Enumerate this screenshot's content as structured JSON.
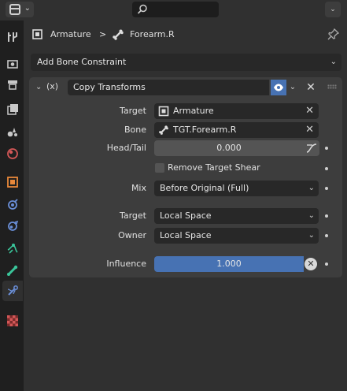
{
  "header": {
    "search_placeholder": ""
  },
  "breadcrumb": {
    "object": "Armature",
    "separator": ">",
    "bone": "Forearm.R"
  },
  "add_constraint": {
    "label": "Add Bone Constraint"
  },
  "constraint": {
    "name": "Copy Transforms",
    "type_symbol": "(x)",
    "fields": {
      "target_label": "Target",
      "target_value": "Armature",
      "bone_label": "Bone",
      "bone_value": "TGT.Forearm.R",
      "headtail_label": "Head/Tail",
      "headtail_value": "0.000",
      "remove_shear_label": "Remove Target Shear",
      "remove_shear_checked": false,
      "mix_label": "Mix",
      "mix_value": "Before Original (Full)",
      "target_space_label": "Target",
      "target_space_value": "Local Space",
      "owner_space_label": "Owner",
      "owner_space_value": "Local Space",
      "influence_label": "Influence",
      "influence_value": "1.000"
    }
  },
  "tabs": [
    {
      "name": "tool-icon",
      "color": "#c8c8c8"
    },
    {
      "name": "render-icon",
      "color": "#c8c8c8"
    },
    {
      "name": "output-icon",
      "color": "#c8c8c8"
    },
    {
      "name": "view-layer-icon",
      "color": "#c8c8c8"
    },
    {
      "name": "scene-icon",
      "color": "#c8c8c8"
    },
    {
      "name": "world-icon",
      "color": "#d25757"
    },
    {
      "name": "object-icon",
      "color": "#e8883a"
    },
    {
      "name": "modifier-icon",
      "color": "#6a8fd8"
    },
    {
      "name": "physics-icon",
      "color": "#6a8fd8"
    },
    {
      "name": "object-constraint-icon",
      "color": "#3ac59a"
    },
    {
      "name": "object-data-icon",
      "color": "#3ac59a"
    },
    {
      "name": "bone-icon",
      "color": "#3ac59a"
    },
    {
      "name": "bone-constraint-icon",
      "color": "#6a8fd8"
    },
    {
      "name": "texture-icon",
      "color": "#d25757"
    }
  ],
  "colors": {
    "accent": "#4772b3",
    "panel": "#3d3d3d",
    "field": "#282828",
    "background": "#303030"
  }
}
